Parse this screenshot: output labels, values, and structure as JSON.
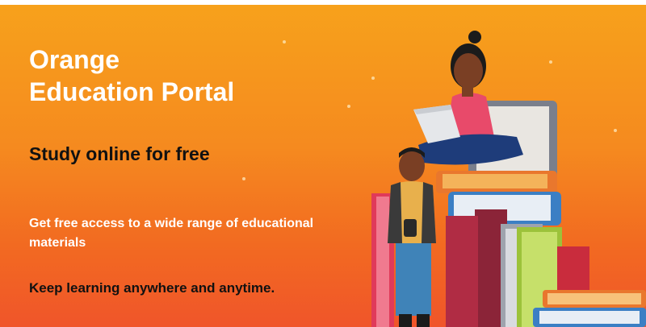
{
  "banner": {
    "title_line1": "Orange",
    "title_line2": "Education Portal",
    "subtitle": "Study online for free",
    "description": "Get free access to a wide range of educational materials",
    "tagline": "Keep learning anywhere and anytime."
  },
  "colors": {
    "background_top": "#f7a21b",
    "background_bottom": "#f0552a",
    "title": "#ffffff",
    "subtitle": "#111111"
  },
  "illustration": {
    "icons": [
      "book-stack-icon",
      "student-with-laptop-icon",
      "student-with-phone-icon"
    ]
  }
}
